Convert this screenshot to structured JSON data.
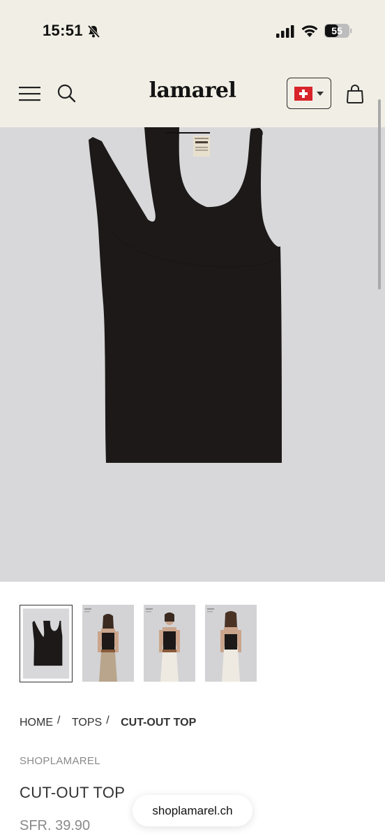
{
  "status_bar": {
    "time": "15:51",
    "battery": "55"
  },
  "header": {
    "logo": "lamarel",
    "country_flag": "switzerland-flag"
  },
  "product": {
    "image_alt": "black cut-out tank top",
    "thumbnails": [
      "product-front",
      "model-front-beige-pants",
      "model-front-white-pants",
      "model-back-white-pants"
    ],
    "active_thumbnail": 0,
    "brand": "SHOPLAMAREL",
    "title": "CUT-OUT TOP",
    "price": "SFR. 39.90"
  },
  "breadcrumb": {
    "items": [
      {
        "label": "HOME"
      },
      {
        "label": "TOPS"
      },
      {
        "label": "CUT-OUT TOP"
      }
    ],
    "separator": "/"
  },
  "browser": {
    "url": "shoplamarel.ch"
  },
  "colors": {
    "header_bg": "#f1efe5",
    "image_bg": "#d8d8da",
    "tank": "#1c1918"
  }
}
